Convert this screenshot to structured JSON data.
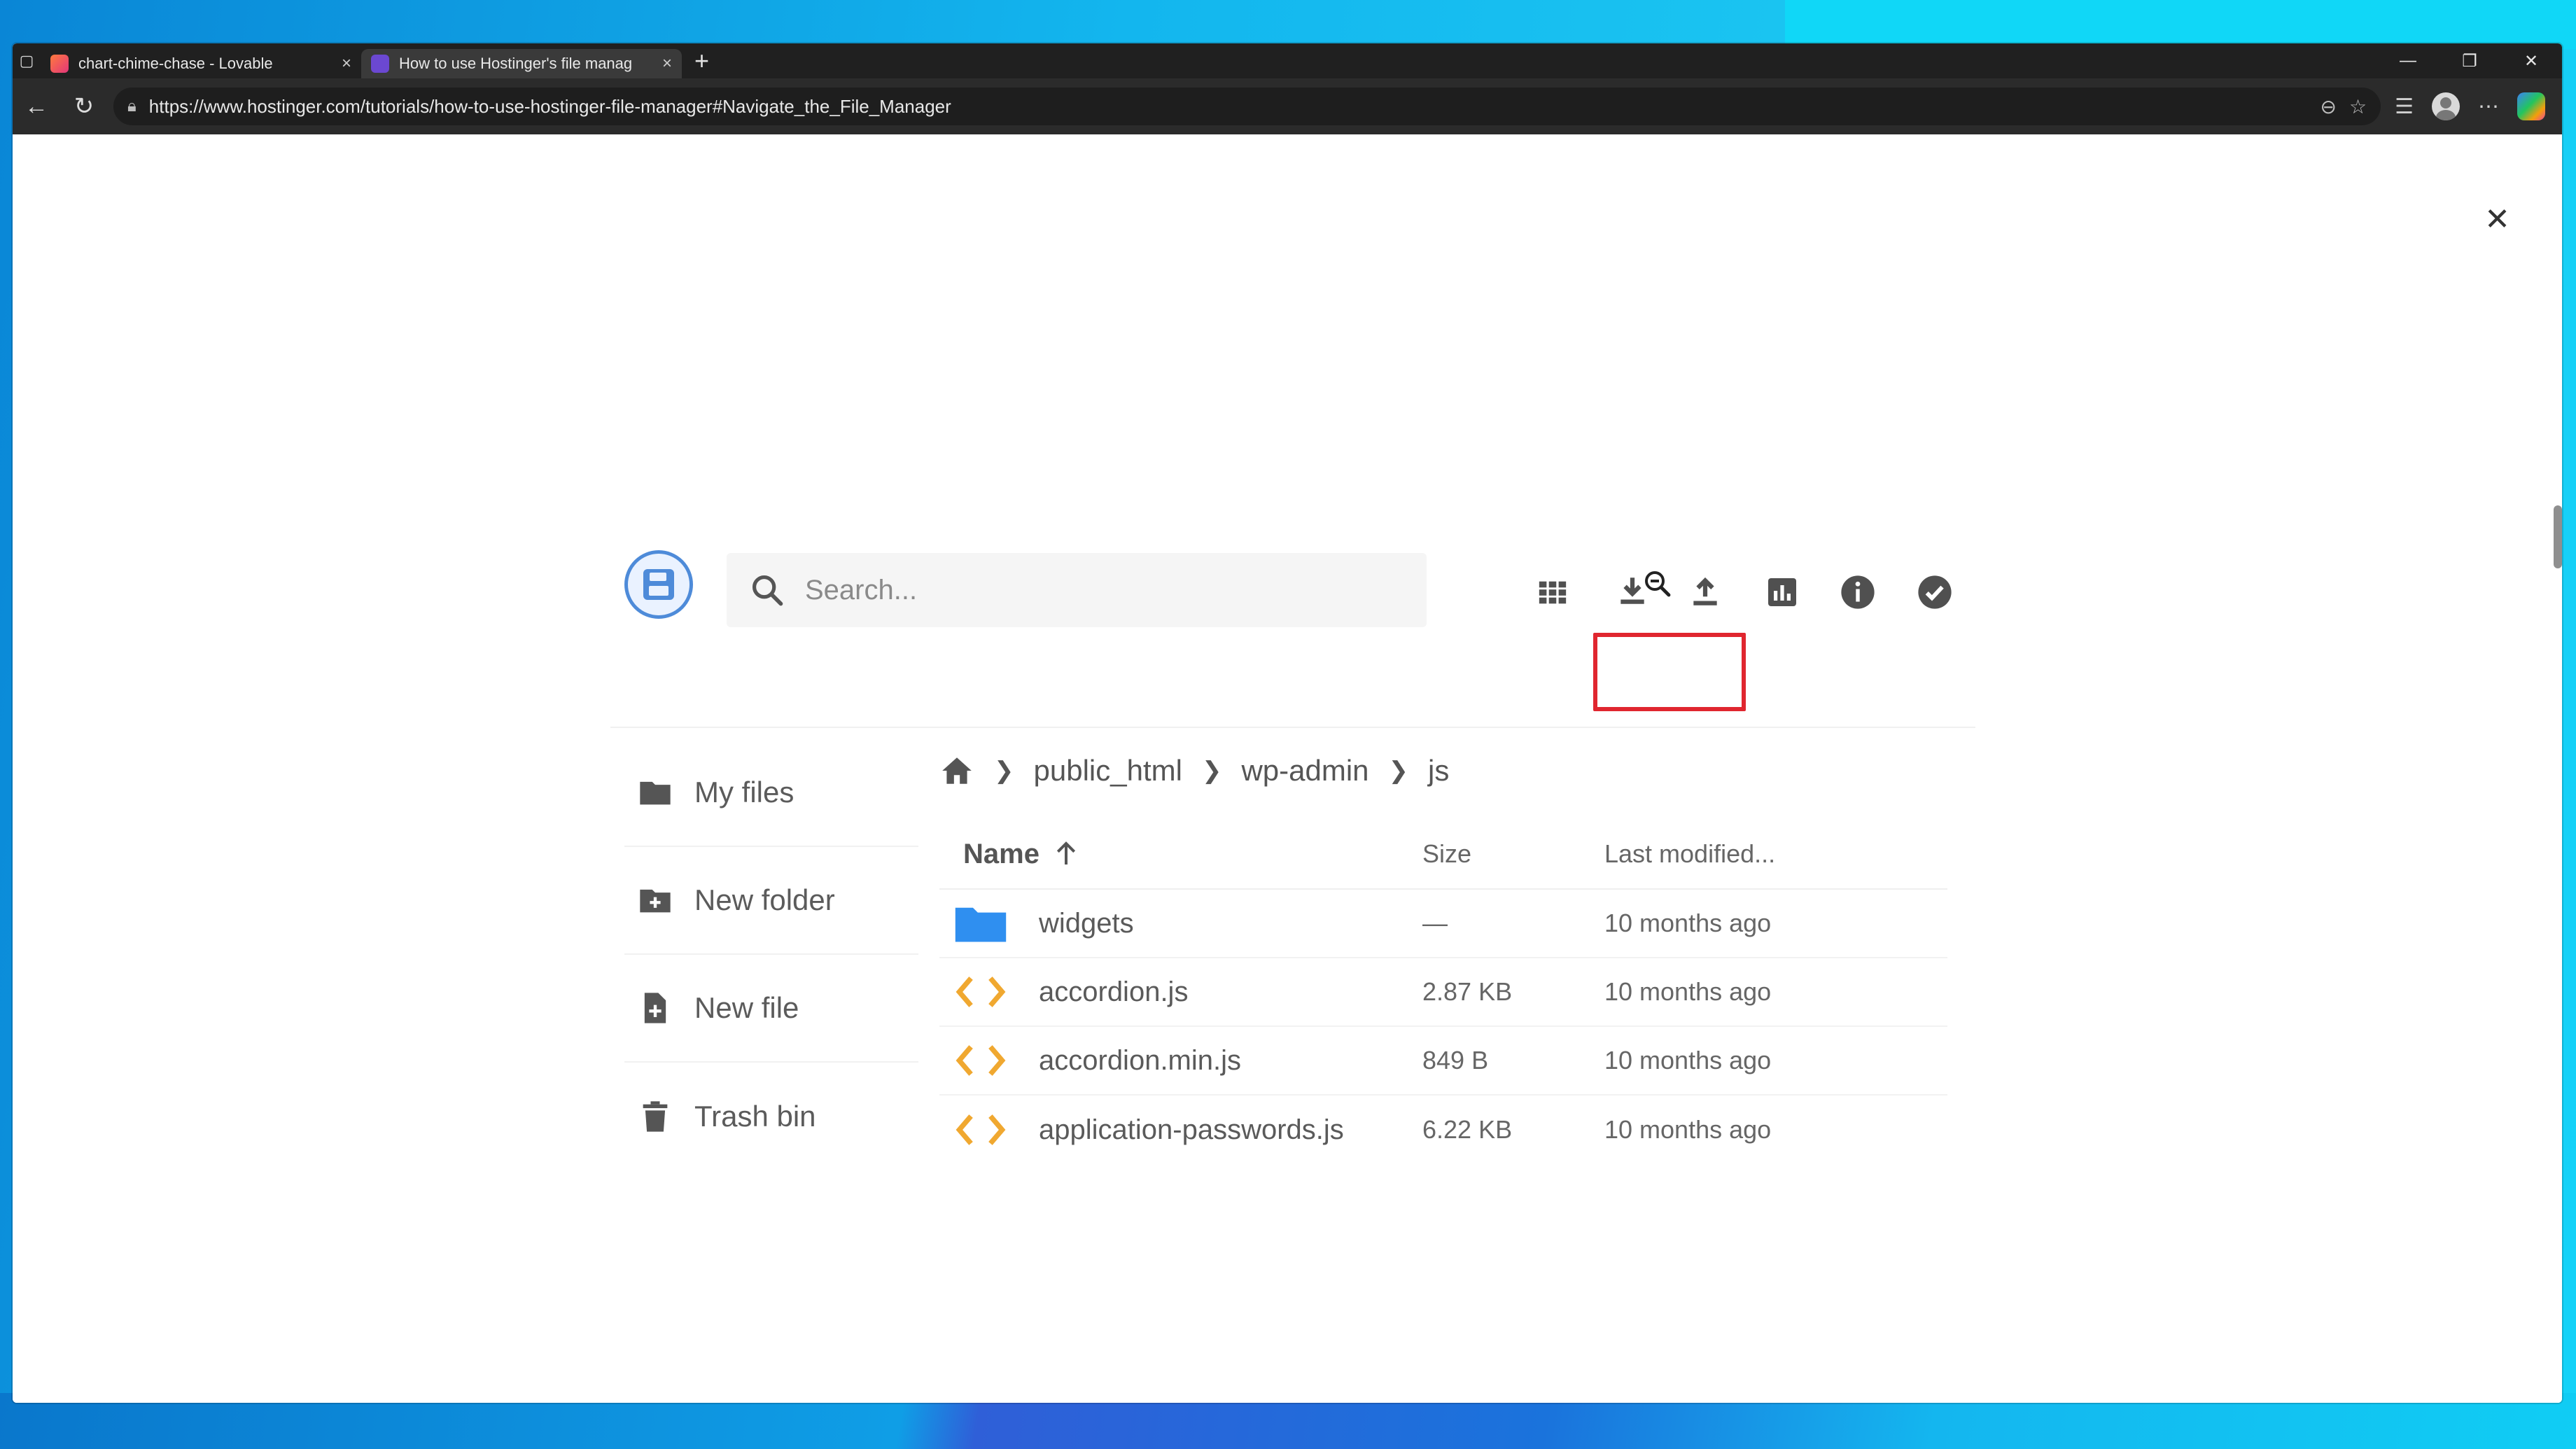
{
  "browser": {
    "tabs": [
      {
        "title": "chart-chime-chase - Lovable",
        "active": false,
        "favicon_color": "#f0544f"
      },
      {
        "title": "How to use Hostinger's file manag",
        "active": true,
        "favicon_color": "#6b48d1"
      }
    ],
    "new_tab_label": "+",
    "url": "https://www.hostinger.com/tutorials/how-to-use-hostinger-file-manager#Navigate_the_File_Manager"
  },
  "file_manager": {
    "search_placeholder": "Search...",
    "sidebar": [
      {
        "label": "My files",
        "icon": "folder-icon"
      },
      {
        "label": "New folder",
        "icon": "new-folder-icon"
      },
      {
        "label": "New file",
        "icon": "new-file-icon"
      },
      {
        "label": "Trash bin",
        "icon": "trash-icon"
      }
    ],
    "breadcrumb": [
      "public_html",
      "wp-admin",
      "js"
    ],
    "columns": {
      "name": "Name",
      "size": "Size",
      "modified": "Last modified..."
    },
    "rows": [
      {
        "name": "widgets",
        "type": "folder",
        "size": "—",
        "modified": "10 months ago"
      },
      {
        "name": "accordion.js",
        "type": "code",
        "size": "2.87 KB",
        "modified": "10 months ago"
      },
      {
        "name": "accordion.min.js",
        "type": "code",
        "size": "849 B",
        "modified": "10 months ago"
      },
      {
        "name": "application-passwords.js",
        "type": "code",
        "size": "6.22 KB",
        "modified": "10 months ago"
      }
    ],
    "highlight_color": "#e0262f",
    "accent_color": "#4e8bd9",
    "folder_color": "#2f8ff0",
    "code_icon_color": "#f0a830"
  }
}
